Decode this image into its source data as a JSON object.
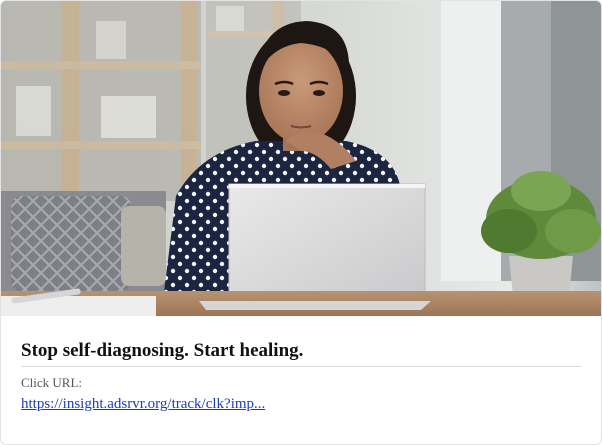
{
  "ad": {
    "headline": "Stop self-diagnosing. Start healing.",
    "click_url_label": "Click URL:",
    "click_url_text": "https://insight.adsrvr.org/track/clk?imp..."
  },
  "colors": {
    "headline": "#111111",
    "link": "#1a3fb8",
    "label": "#555555"
  }
}
